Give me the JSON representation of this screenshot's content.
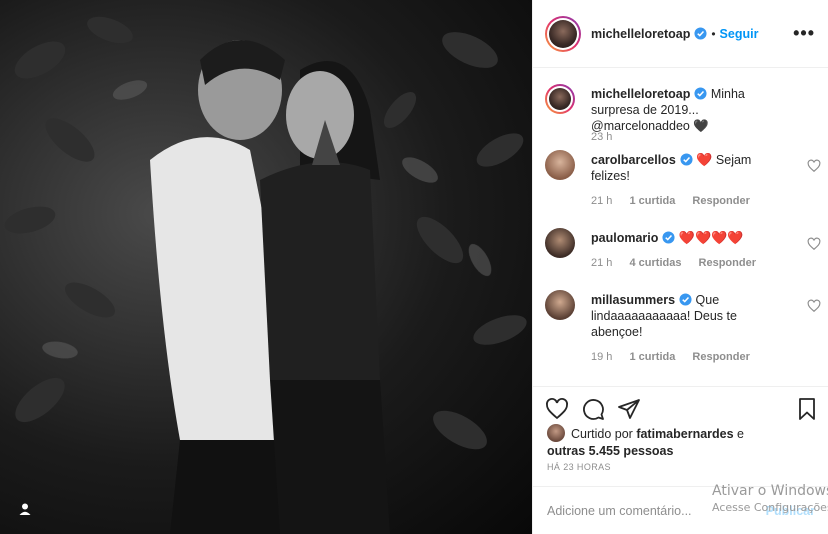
{
  "post": {
    "author": "michelleloretoap",
    "follow_label": "Seguir",
    "more_label": "•••",
    "separator": "•"
  },
  "caption": {
    "username": "michelleloretoap",
    "text": " Minha surpresa de 2019... @marcelonaddeo",
    "emoji": "🖤",
    "time": "23 h"
  },
  "comments": [
    {
      "username": "carolbarcellos",
      "text": " Sejam felizes!",
      "emoji": "❤️",
      "time": "21 h",
      "likes": "1 curtida",
      "reply": "Responder"
    },
    {
      "username": "paulomario",
      "text": "",
      "emoji": "❤️❤️❤️❤️",
      "time": "21 h",
      "likes": "4 curtidas",
      "reply": "Responder"
    },
    {
      "username": "millasummers",
      "text": " Que lindaaaaaaaaaaa! Deus te abençoe!",
      "emoji": "",
      "time": "19 h",
      "likes": "1 curtida",
      "reply": "Responder"
    }
  ],
  "likes_info": {
    "prefix": "Curtido por ",
    "user": "fatimabernardes",
    "middle": " e ",
    "others": "outras 5.455 pessoas"
  },
  "time_ago": "HÁ 23 HORAS",
  "add_comment": {
    "placeholder": "Adicione um comentário...",
    "publish_label": "Publicar"
  },
  "watermark": {
    "line1": "Ativar o Windows",
    "line2": "Acesse Configurações"
  },
  "colors": {
    "accent": "#0095f6",
    "heart": "#ed4956",
    "muted": "#8e8e8e"
  }
}
